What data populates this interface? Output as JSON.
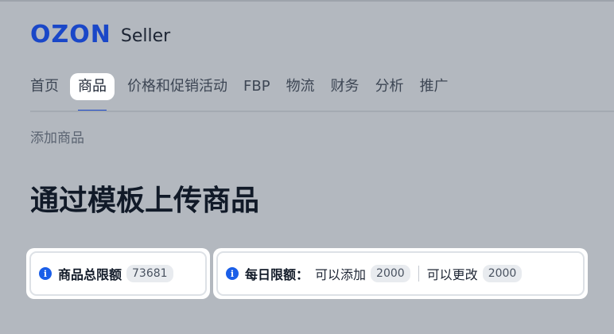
{
  "logo": {
    "brand": "OZON",
    "product": "Seller"
  },
  "nav": {
    "items": [
      {
        "label": "首页"
      },
      {
        "label": "商品"
      },
      {
        "label": "价格和促销活动"
      },
      {
        "label": "FBP"
      },
      {
        "label": "物流"
      },
      {
        "label": "财务"
      },
      {
        "label": "分析"
      },
      {
        "label": "推广"
      }
    ],
    "active": "商品"
  },
  "breadcrumb": "添加商品",
  "page_title": "通过模板上传商品",
  "limits": {
    "total": {
      "icon": "info-icon",
      "label": "商品总限额",
      "value": "73681"
    },
    "daily": {
      "icon": "info-icon",
      "label": "每日限额：",
      "add_text": "可以添加",
      "add_value": "2000",
      "edit_text": "可以更改",
      "edit_value": "2000"
    }
  },
  "colors": {
    "brand": "#1a47c8",
    "overlay_background": "#b3b8bf",
    "info_icon": "#1a5ee8"
  }
}
